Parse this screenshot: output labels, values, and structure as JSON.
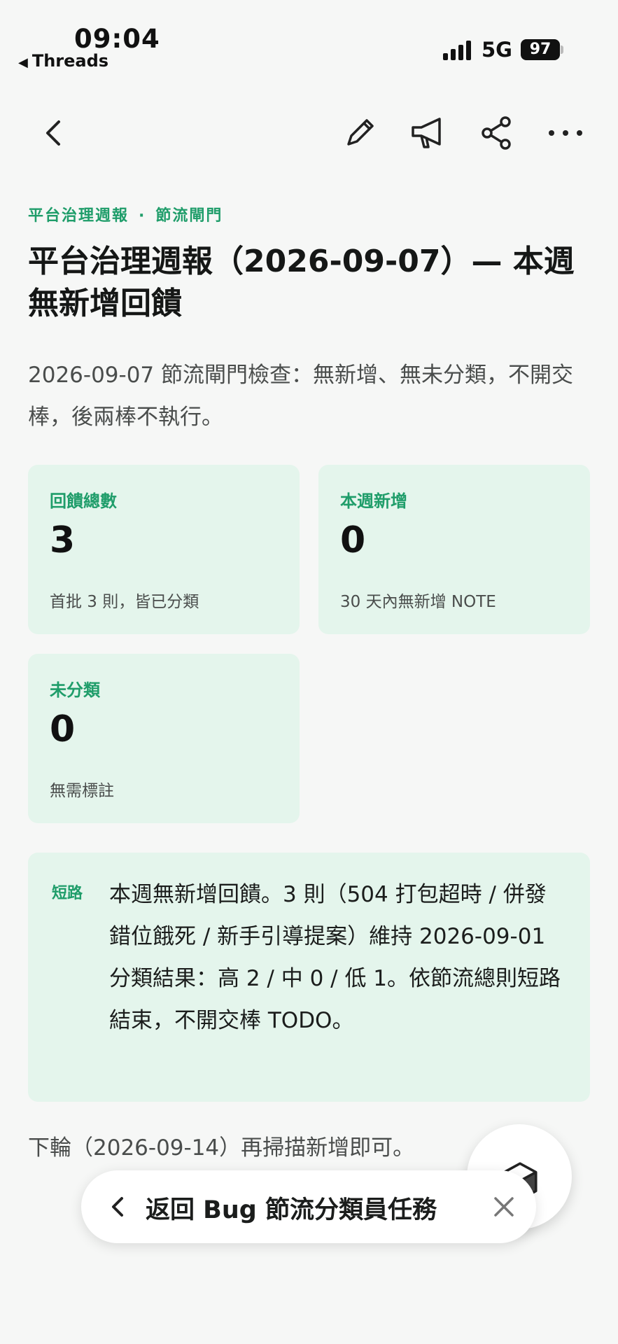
{
  "status_bar": {
    "time": "09:04",
    "back_app": "Threads",
    "network": "5G",
    "battery": "97"
  },
  "toolbar": {
    "icons": [
      "back-icon",
      "edit-icon",
      "megaphone-icon",
      "share-icon",
      "more-icon"
    ]
  },
  "breadcrumb": {
    "part1": "平台治理週報",
    "separator": "·",
    "part2": "節流閘門"
  },
  "article": {
    "title": "平台治理週報（2026-09-07）— 本週無新增回饋",
    "summary": "2026-09-07 節流閘門檢查：無新增、無未分類，不開交棒，後兩棒不執行。"
  },
  "cards": [
    {
      "label": "回饋總數",
      "value": "3",
      "note": "首批 3 則，皆已分類"
    },
    {
      "label": "本週新增",
      "value": "0",
      "note": "30 天內無新增 NOTE"
    },
    {
      "label": "未分類",
      "value": "0",
      "note": "無需標註"
    }
  ],
  "shortcut": {
    "tag": "短路",
    "text": "本週無新增回饋。3 則（504 打包超時 / 併發錯位餓死 / 新手引導提案）維持 2026-09-01 分類結果：高 2 / 中 0 / 低 1。依節流總則短路結束，不開交棒 TODO。"
  },
  "next_round": "下輪（2026-09-14）再掃描新增即可。",
  "return_bar": {
    "label": "返回 Bug 節流分類員任務"
  },
  "colors": {
    "accent": "#1f9d6a",
    "card_bg": "#e4f5ec",
    "page_bg": "#f6f7f6"
  }
}
